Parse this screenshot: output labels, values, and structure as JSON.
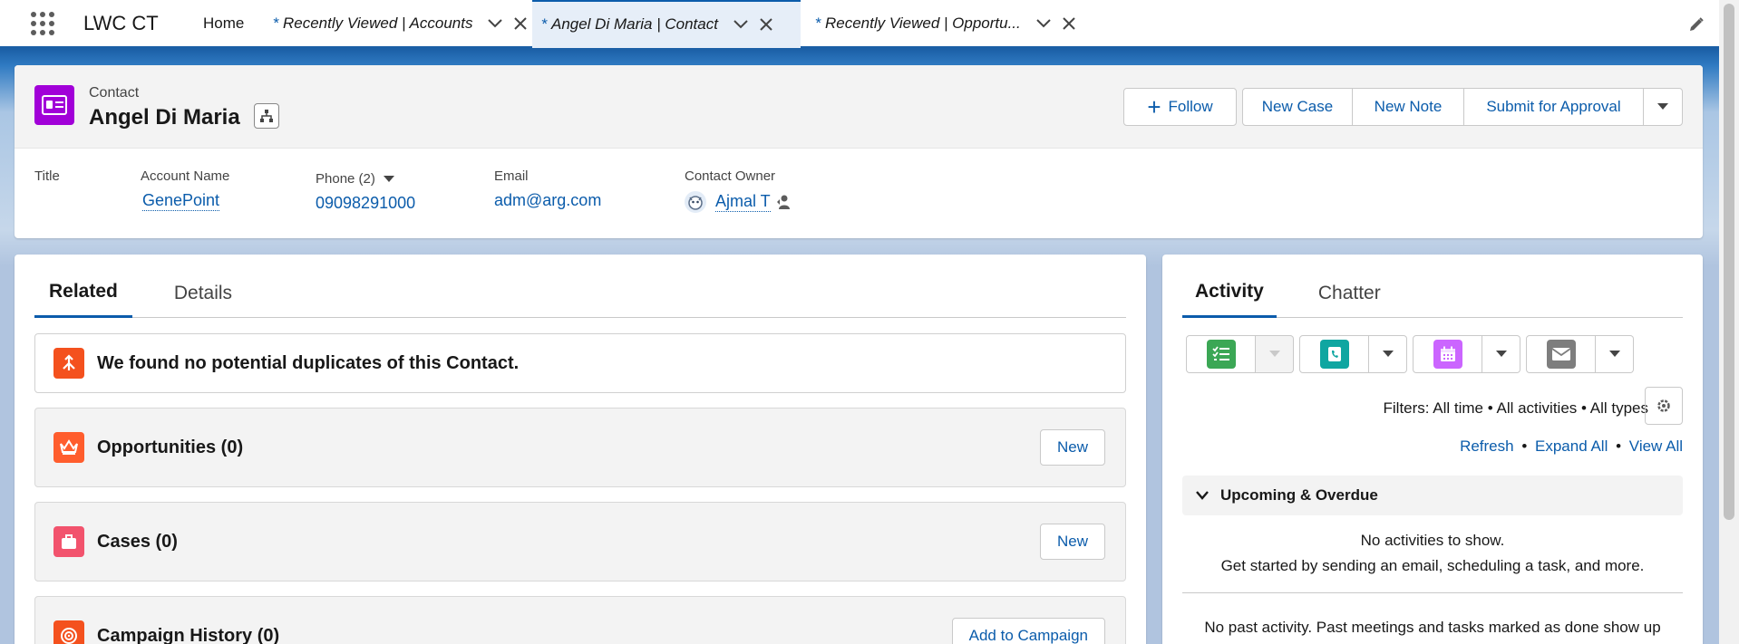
{
  "nav": {
    "app_name": "LWC CT",
    "home": "Home",
    "tabs": [
      {
        "label": "Recently Viewed | Accounts",
        "modified": "*",
        "active": false
      },
      {
        "label": "Angel Di Maria | Contact",
        "modified": "*",
        "active": true
      },
      {
        "label": "Recently Viewed | Opportu...",
        "modified": "*",
        "active": false
      }
    ]
  },
  "record": {
    "object_type": "Contact",
    "name": "Angel Di Maria",
    "actions": {
      "follow": "Follow",
      "new_case": "New Case",
      "new_note": "New Note",
      "submit": "Submit for Approval"
    },
    "fields": {
      "title_label": "Title",
      "title_value": "",
      "account_label": "Account Name",
      "account_value": "GenePoint",
      "phone_label": "Phone (2)",
      "phone_value": "09098291000",
      "email_label": "Email",
      "email_value": "adm@arg.com",
      "owner_label": "Contact Owner",
      "owner_value": "Ajmal T"
    }
  },
  "related": {
    "tabs": [
      "Related",
      "Details"
    ],
    "duplicates_text": "We found no potential duplicates of this Contact.",
    "lists": [
      {
        "title": "Opportunities (0)",
        "button": "New",
        "color": "#ff5d2d"
      },
      {
        "title": "Cases (0)",
        "button": "New",
        "color": "#f2536d"
      },
      {
        "title": "Campaign History (0)",
        "button": "Add to Campaign",
        "color": "#f4511e"
      }
    ]
  },
  "activity": {
    "tabs": [
      "Activity",
      "Chatter"
    ],
    "filters": "Filters: All time • All activities • All types",
    "refresh": "Refresh",
    "expand_all": "Expand All",
    "view_all": "View All",
    "separator": "•",
    "upcoming_title": "Upcoming & Overdue",
    "no_activities": "No activities to show.",
    "get_started": "Get started by sending an email, scheduling a task, and more.",
    "no_past": "No past activity. Past meetings and tasks marked as done show up",
    "colors": {
      "task": "#3ba755",
      "log_call": "#0fa6a1",
      "event": "#cb65ff",
      "email": "#7e7e7e"
    }
  }
}
